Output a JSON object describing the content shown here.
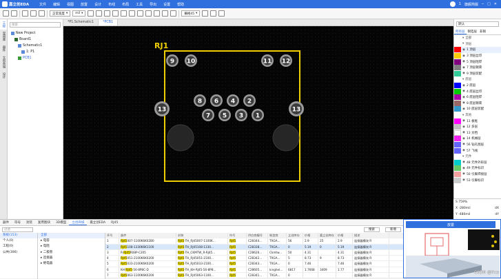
{
  "app": {
    "logo": "嘉立创EDA",
    "user": "1",
    "top_right": "旗舰简版"
  },
  "menu": [
    "文件",
    "编辑",
    "视图",
    "放置",
    "设计",
    "布线",
    "布局",
    "工具",
    "导出",
    "设置",
    "帮助"
  ],
  "toolbar": {
    "unit": "mil",
    "routing": "正常宽度",
    "grid": "栅格45"
  },
  "left_strip": [
    "工程",
    "常用库",
    "器件",
    "立创商城",
    "设计"
  ],
  "project": {
    "search_placeholder": "搜索",
    "tree": [
      {
        "label": "New Project",
        "indent": 1
      },
      {
        "label": "Board1",
        "indent": 2
      },
      {
        "label": "Schematic1",
        "indent": 3
      },
      {
        "label": "1: P1",
        "indent": 4
      },
      {
        "label": "PCB1",
        "indent": 3
      }
    ]
  },
  "doc_tabs": [
    "*P1.Schematic1",
    "*PCB1"
  ],
  "footprint": {
    "designator": "RJ1",
    "pads": [
      "9",
      "10",
      "11",
      "12",
      "13",
      "13",
      "8",
      "6",
      "4",
      "2",
      "7",
      "5",
      "3",
      "1"
    ]
  },
  "right_panel": {
    "selector": "默认",
    "tabs": [
      "所有层",
      "铜箔层",
      "非铜"
    ],
    "layers": [
      {
        "name": "全部",
        "group": true,
        "color": ""
      },
      {
        "name": "顶层",
        "group": true,
        "color": ""
      },
      {
        "name": "1 顶层",
        "group": false,
        "color": "#ff0000"
      },
      {
        "name": "3 顶层丝印",
        "group": false,
        "color": "#ffcc00"
      },
      {
        "name": "5 顶层阻焊",
        "group": false,
        "color": "#800080"
      },
      {
        "name": "7 顶层锡膏",
        "group": false,
        "color": "#808080"
      },
      {
        "name": "9 顶层装配",
        "group": false,
        "color": "#33cc99"
      },
      {
        "name": "底层",
        "group": true,
        "color": ""
      },
      {
        "name": "2 底层",
        "group": false,
        "color": "#0000ff"
      },
      {
        "name": "4 底层丝印",
        "group": false,
        "color": "#00cc00"
      },
      {
        "name": "6 底层阻焊",
        "group": false,
        "color": "#aa00aa"
      },
      {
        "name": "8 底层锡膏",
        "group": false,
        "color": "#996666"
      },
      {
        "name": "10 底层装配",
        "group": false,
        "color": "#3399cc"
      },
      {
        "name": "其他",
        "group": true,
        "color": ""
      },
      {
        "name": "11 板框",
        "group": false,
        "color": "#ff00ff"
      },
      {
        "name": "12 多层",
        "group": false,
        "color": "#c0c0c0"
      },
      {
        "name": "13 文档",
        "group": false,
        "color": "#ffffff"
      },
      {
        "name": "14 机械层",
        "group": false,
        "color": "#f022f0"
      },
      {
        "name": "56 钻孔图层",
        "group": false,
        "color": "#6464ff"
      },
      {
        "name": "57 飞线",
        "group": false,
        "color": "#6464ff"
      },
      {
        "name": "元件",
        "group": true,
        "color": ""
      },
      {
        "name": "48 元件外形层",
        "group": false,
        "color": "#00cccc"
      },
      {
        "name": "49 元件标识",
        "group": false,
        "color": "#66cc66"
      },
      {
        "name": "50 引脚焊接层",
        "group": false,
        "color": "#f5a0a0"
      },
      {
        "name": "53 引脚标识",
        "group": false,
        "color": "#cccccc"
      }
    ],
    "coords": [
      {
        "label": "S",
        "value": "759%",
        "label2": "",
        "value2": ""
      },
      {
        "label": "X",
        "value": "-280mil",
        "label2": "dX",
        "value2": ""
      },
      {
        "label": "Y",
        "value": "-480mil",
        "label2": "dY",
        "value2": ""
      }
    ]
  },
  "bottom": {
    "tabs": [
      "器件",
      "符号",
      "封装",
      "复用图块",
      "3D模型",
      "立创商城",
      "嘉立创EDA",
      "RJ45"
    ],
    "filter_placeholder": "过滤",
    "search_btn": "搜索",
    "place_btn": "放置",
    "new_btn": "新增",
    "side": [
      "系统(153)",
      "个人(0)",
      "工程(0)",
      "公共(306)"
    ],
    "categories": [
      "全部",
      "电容",
      "电阻",
      "二极管",
      "连接器",
      "继电器"
    ],
    "columns": [
      "序号",
      "器件",
      "封装",
      "符号",
      "供应商编号",
      "制造商",
      "立创库存",
      "价格",
      "嘉立创库存",
      "价格",
      "描述"
    ],
    "rows": [
      [
        "1",
        "RJ45007-1100K6K02B0",
        "RJ45-TH_RJ45007-1100K...",
        "RJ45",
        "C28344...",
        "TXGA...",
        "56",
        "2.9",
        "25",
        "2.9",
        "连接器模块 R"
      ],
      [
        "2",
        "RJ45108-1330K6K1100",
        "RJ45-TH_RJ45108-1330...",
        "RJ45",
        "C28338...",
        "TXGA...",
        "0",
        "5.19",
        "0",
        "5.19",
        "连接器模块 R"
      ],
      [
        "3",
        "R-RJ45R08P-C205",
        "RJ45-TH_CKMTW_R-RJ45...",
        "RJ45",
        "C28626...",
        "Ckmtw...",
        "50",
        "4.31",
        "",
        "4.31",
        "连接器模块 R"
      ],
      [
        "4",
        "RJ45051-2100K6K0200",
        "RJ45-TH_RJ45051-2100...",
        "RJ45",
        "C28342...",
        "TXGA...",
        "5",
        "8.73",
        "9",
        "8.73",
        "连接器模块 R"
      ],
      [
        "5",
        "RJ45033-2100K6K0200",
        "RJ45-TH_RJ45033-2100...",
        "RJ45",
        "C28343...",
        "TXGA...",
        "0",
        "7.46",
        "",
        "7.46",
        "连接器模块 R"
      ],
      [
        "6",
        "KH-RJ45-56-8P8C-D",
        "RJ45-TH_KH-RJ45-56-8P8...",
        "RJ45",
        "C28605...",
        "kinghel...",
        "6817",
        "1.7668",
        "3409",
        "1.77",
        "连接器模块 R"
      ],
      [
        "7",
        "RJ45063-1100K6K0200",
        "RJ45-TH_RJ45063-1100...",
        "RJ45",
        "C28341...",
        "TXGA...",
        "0",
        "",
        "",
        "",
        "连接器模块 R"
      ]
    ]
  },
  "watermark": "CSDN @P.cs"
}
